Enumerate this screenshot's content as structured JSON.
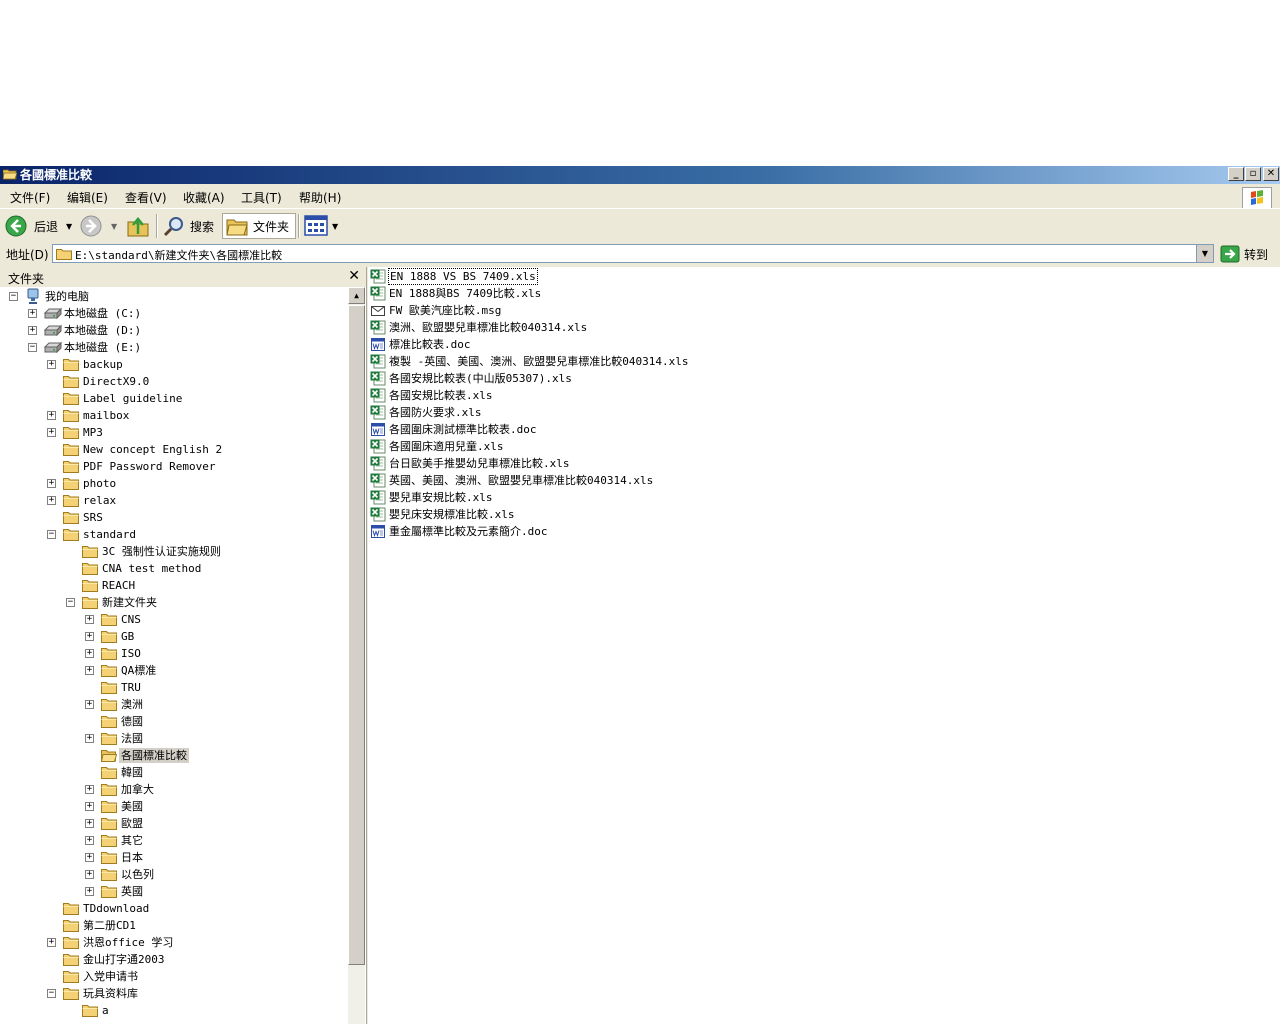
{
  "window": {
    "title": "各國標准比較",
    "controls": {
      "minimize": "_",
      "restore": "▫",
      "close": "✕"
    }
  },
  "menu": [
    "文件(F)",
    "编辑(E)",
    "查看(V)",
    "收藏(A)",
    "工具(T)",
    "帮助(H)"
  ],
  "toolbar": {
    "back_label": "后退",
    "search_label": "搜索",
    "folders_label": "文件夹"
  },
  "address": {
    "label": "地址(D)",
    "value": "E:\\standard\\新建文件夹\\各國標准比較",
    "go_label": "转到"
  },
  "folder_pane": {
    "header": "文件夹",
    "close": "✕",
    "tree": [
      {
        "label": "我的电脑",
        "level": 0,
        "expander": "minus",
        "icon": "computer-icon"
      },
      {
        "label": "本地磁盘 (C:)",
        "level": 1,
        "expander": "plus",
        "icon": "drive-icon"
      },
      {
        "label": "本地磁盘 (D:)",
        "level": 1,
        "expander": "plus",
        "icon": "drive-icon"
      },
      {
        "label": "本地磁盘 (E:)",
        "level": 1,
        "expander": "minus",
        "icon": "drive-icon"
      },
      {
        "label": "backup",
        "level": 2,
        "expander": "plus",
        "icon": "folder-icon"
      },
      {
        "label": "DirectX9.0",
        "level": 2,
        "expander": "none",
        "icon": "folder-icon"
      },
      {
        "label": "Label guideline",
        "level": 2,
        "expander": "none",
        "icon": "folder-icon"
      },
      {
        "label": "mailbox",
        "level": 2,
        "expander": "plus",
        "icon": "folder-icon"
      },
      {
        "label": "MP3",
        "level": 2,
        "expander": "plus",
        "icon": "folder-icon"
      },
      {
        "label": "New concept English 2",
        "level": 2,
        "expander": "none",
        "icon": "folder-icon"
      },
      {
        "label": "PDF Password Remover",
        "level": 2,
        "expander": "none",
        "icon": "folder-icon"
      },
      {
        "label": "photo",
        "level": 2,
        "expander": "plus",
        "icon": "folder-icon"
      },
      {
        "label": "relax",
        "level": 2,
        "expander": "plus",
        "icon": "folder-icon"
      },
      {
        "label": "SRS",
        "level": 2,
        "expander": "none",
        "icon": "folder-icon"
      },
      {
        "label": "standard",
        "level": 2,
        "expander": "minus",
        "icon": "folder-icon"
      },
      {
        "label": "3C 强制性认证实施规则",
        "level": 3,
        "expander": "none",
        "icon": "folder-icon"
      },
      {
        "label": "CNA test method",
        "level": 3,
        "expander": "none",
        "icon": "folder-icon"
      },
      {
        "label": "REACH",
        "level": 3,
        "expander": "none",
        "icon": "folder-icon"
      },
      {
        "label": "新建文件夹",
        "level": 3,
        "expander": "minus",
        "icon": "folder-icon"
      },
      {
        "label": "CNS",
        "level": 4,
        "expander": "plus",
        "icon": "folder-icon"
      },
      {
        "label": "GB",
        "level": 4,
        "expander": "plus",
        "icon": "folder-icon"
      },
      {
        "label": "ISO",
        "level": 4,
        "expander": "plus",
        "icon": "folder-icon"
      },
      {
        "label": "QA標准",
        "level": 4,
        "expander": "plus",
        "icon": "folder-icon"
      },
      {
        "label": "TRU",
        "level": 4,
        "expander": "none",
        "icon": "folder-icon"
      },
      {
        "label": "澳洲",
        "level": 4,
        "expander": "plus",
        "icon": "folder-icon"
      },
      {
        "label": "德國",
        "level": 4,
        "expander": "none",
        "icon": "folder-icon"
      },
      {
        "label": "法國",
        "level": 4,
        "expander": "plus",
        "icon": "folder-icon"
      },
      {
        "label": "各國標准比較",
        "level": 4,
        "expander": "none",
        "icon": "open-folder-icon",
        "selected": true
      },
      {
        "label": "韓國",
        "level": 4,
        "expander": "none",
        "icon": "folder-icon"
      },
      {
        "label": "加拿大",
        "level": 4,
        "expander": "plus",
        "icon": "folder-icon"
      },
      {
        "label": "美國",
        "level": 4,
        "expander": "plus",
        "icon": "folder-icon"
      },
      {
        "label": "歐盟",
        "level": 4,
        "expander": "plus",
        "icon": "folder-icon"
      },
      {
        "label": "其它",
        "level": 4,
        "expander": "plus",
        "icon": "folder-icon"
      },
      {
        "label": "日本",
        "level": 4,
        "expander": "plus",
        "icon": "folder-icon"
      },
      {
        "label": "以色列",
        "level": 4,
        "expander": "plus",
        "icon": "folder-icon"
      },
      {
        "label": "英國",
        "level": 4,
        "expander": "plus",
        "icon": "folder-icon"
      },
      {
        "label": "TDdownload",
        "level": 2,
        "expander": "none",
        "icon": "folder-icon"
      },
      {
        "label": "第二册CD1",
        "level": 2,
        "expander": "none",
        "icon": "folder-icon"
      },
      {
        "label": "洪恩office 学习",
        "level": 2,
        "expander": "plus",
        "icon": "folder-icon"
      },
      {
        "label": "金山打字通2003",
        "level": 2,
        "expander": "none",
        "icon": "folder-icon"
      },
      {
        "label": "入党申请书",
        "level": 2,
        "expander": "none",
        "icon": "folder-icon"
      },
      {
        "label": "玩具资料库",
        "level": 2,
        "expander": "minus",
        "icon": "folder-icon"
      },
      {
        "label": "a",
        "level": 3,
        "expander": "none",
        "icon": "folder-icon"
      }
    ]
  },
  "files": [
    {
      "name": "EN 1888  VS BS 7409.xls",
      "type": "xls",
      "selected": true
    },
    {
      "name": "EN 1888與BS 7409比較.xls",
      "type": "xls"
    },
    {
      "name": "FW  歐美汽座比較.msg",
      "type": "msg"
    },
    {
      "name": "澳洲、歐盟嬰兒車標准比較040314.xls",
      "type": "xls"
    },
    {
      "name": "標准比較表.doc",
      "type": "doc"
    },
    {
      "name": "複製 -英國、美國、澳洲、歐盟嬰兒車標准比較040314.xls",
      "type": "xls"
    },
    {
      "name": "各國安規比較表(中山版05307).xls",
      "type": "xls"
    },
    {
      "name": "各國安規比較表.xls",
      "type": "xls"
    },
    {
      "name": "各國防火要求.xls",
      "type": "xls"
    },
    {
      "name": "各國圍床測試標準比較表.doc",
      "type": "doc"
    },
    {
      "name": "各國圍床適用兒童.xls",
      "type": "xls"
    },
    {
      "name": "台日歐美手推嬰幼兒車標准比較.xls",
      "type": "xls"
    },
    {
      "name": "英國、美國、澳洲、歐盟嬰兒車標准比較040314.xls",
      "type": "xls"
    },
    {
      "name": "嬰兒車安規比較.xls",
      "type": "xls"
    },
    {
      "name": "嬰兒床安規標准比較.xls",
      "type": "xls"
    },
    {
      "name": "重金屬標準比較及元素簡介.doc",
      "type": "doc"
    }
  ],
  "colors": {
    "titlebar": "#0a246a",
    "selection": "#d4d0c8",
    "excel_green": "#1d7a3a",
    "word_blue": "#2b4fa8"
  }
}
